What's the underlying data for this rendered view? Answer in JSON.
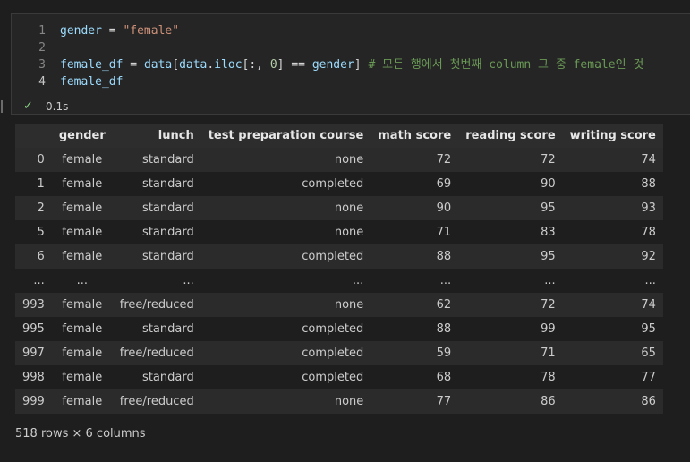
{
  "cell": {
    "lines": [
      {
        "n": "1",
        "tokens": [
          {
            "t": "gender",
            "k": "v"
          },
          {
            "t": " = ",
            "k": "o"
          },
          {
            "t": "\"female\"",
            "k": "s"
          }
        ]
      },
      {
        "n": "2",
        "tokens": []
      },
      {
        "n": "3",
        "tokens": [
          {
            "t": "female_df",
            "k": "v"
          },
          {
            "t": " = ",
            "k": "o"
          },
          {
            "t": "data",
            "k": "v"
          },
          {
            "t": "[",
            "k": "o"
          },
          {
            "t": "data",
            "k": "v"
          },
          {
            "t": ".",
            "k": "o"
          },
          {
            "t": "iloc",
            "k": "v"
          },
          {
            "t": "[:, ",
            "k": "o"
          },
          {
            "t": "0",
            "k": "n"
          },
          {
            "t": "] == ",
            "k": "o"
          },
          {
            "t": "gender",
            "k": "v"
          },
          {
            "t": "] ",
            "k": "o"
          },
          {
            "t": "# 모든 행에서 첫번째 column 그 중 female인 것",
            "k": "c"
          }
        ]
      },
      {
        "n": "4",
        "tokens": [
          {
            "t": "female_df",
            "k": "v"
          }
        ]
      }
    ],
    "active_line": "4",
    "exec_status": "✓",
    "exec_time": "0.1s"
  },
  "table": {
    "columns": [
      "",
      "gender",
      "lunch",
      "test preparation course",
      "math score",
      "reading score",
      "writing score"
    ],
    "rows": [
      [
        "0",
        "female",
        "standard",
        "none",
        "72",
        "72",
        "74"
      ],
      [
        "1",
        "female",
        "standard",
        "completed",
        "69",
        "90",
        "88"
      ],
      [
        "2",
        "female",
        "standard",
        "none",
        "90",
        "95",
        "93"
      ],
      [
        "5",
        "female",
        "standard",
        "none",
        "71",
        "83",
        "78"
      ],
      [
        "6",
        "female",
        "standard",
        "completed",
        "88",
        "95",
        "92"
      ],
      [
        "...",
        "...",
        "...",
        "...",
        "...",
        "...",
        "..."
      ],
      [
        "993",
        "female",
        "free/reduced",
        "none",
        "62",
        "72",
        "74"
      ],
      [
        "995",
        "female",
        "standard",
        "completed",
        "88",
        "99",
        "95"
      ],
      [
        "997",
        "female",
        "free/reduced",
        "completed",
        "59",
        "71",
        "65"
      ],
      [
        "998",
        "female",
        "standard",
        "completed",
        "68",
        "78",
        "77"
      ],
      [
        "999",
        "female",
        "free/reduced",
        "none",
        "77",
        "86",
        "86"
      ]
    ],
    "shape_text": "518 rows × 6 columns"
  }
}
